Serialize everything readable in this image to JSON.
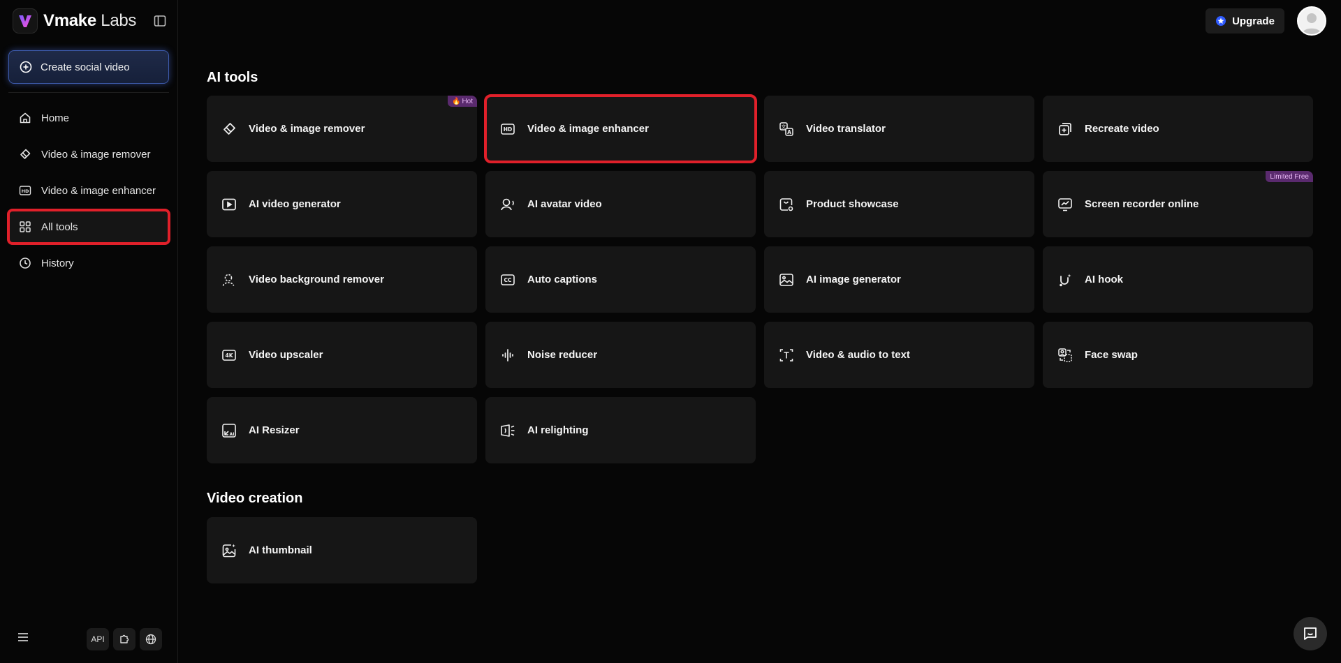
{
  "brand": {
    "name_bold": "Vmake",
    "name_light": " Labs"
  },
  "sidebar": {
    "create_label": "Create social video",
    "items": [
      {
        "label": "Home",
        "icon": "home-icon"
      },
      {
        "label": "Video & image remover",
        "icon": "eraser-icon"
      },
      {
        "label": "Video & image enhancer",
        "icon": "hd-icon"
      },
      {
        "label": "All tools",
        "icon": "grid-icon",
        "active": true
      },
      {
        "label": "History",
        "icon": "clock-icon"
      }
    ],
    "bottom": {
      "api_label": "API"
    }
  },
  "header": {
    "upgrade_label": "Upgrade"
  },
  "sections": {
    "ai_tools_title": "AI tools",
    "video_creation_title": "Video creation"
  },
  "tools": [
    {
      "label": "Video & image remover",
      "icon": "eraser-icon",
      "badge": "Hot"
    },
    {
      "label": "Video & image enhancer",
      "icon": "hd-icon",
      "highlighted": true
    },
    {
      "label": "Video translator",
      "icon": "translate-icon"
    },
    {
      "label": "Recreate video",
      "icon": "recreate-icon"
    },
    {
      "label": "AI video generator",
      "icon": "play-icon"
    },
    {
      "label": "AI avatar video",
      "icon": "avatar-icon"
    },
    {
      "label": "Product showcase",
      "icon": "showcase-icon"
    },
    {
      "label": "Screen recorder online",
      "icon": "chart-icon",
      "badge": "Limited Free"
    },
    {
      "label": "Video background remover",
      "icon": "person-remove-icon"
    },
    {
      "label": "Auto captions",
      "icon": "cc-icon"
    },
    {
      "label": "AI image generator",
      "icon": "image-icon"
    },
    {
      "label": "AI hook",
      "icon": "magnet-icon"
    },
    {
      "label": "Video upscaler",
      "icon": "4k-icon"
    },
    {
      "label": "Noise reducer",
      "icon": "waveform-icon"
    },
    {
      "label": "Video & audio to text",
      "icon": "text-icon"
    },
    {
      "label": "Face swap",
      "icon": "face-swap-icon"
    },
    {
      "label": "AI Resizer",
      "icon": "resize-icon"
    },
    {
      "label": "AI relighting",
      "icon": "light-icon"
    }
  ],
  "video_creation": [
    {
      "label": "AI thumbnail",
      "icon": "thumbnail-icon"
    }
  ],
  "colors": {
    "accent": "#3e5cae",
    "highlight": "#e0202a",
    "badge_bg": "#5a2a6e",
    "card_bg": "#161616"
  }
}
